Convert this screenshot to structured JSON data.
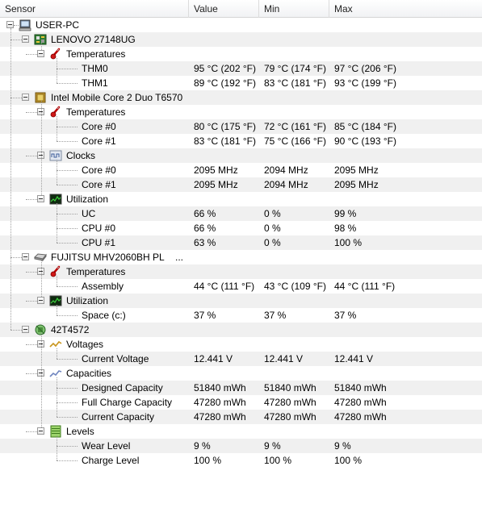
{
  "columns": {
    "sensor": "Sensor",
    "value": "Value",
    "min": "Min",
    "max": "Max"
  },
  "tree": {
    "root": "USER-PC",
    "devices": [
      {
        "name": "LENOVO 27148UG",
        "icon": "motherboard-icon",
        "groups": [
          {
            "name": "Temperatures",
            "icon": "thermometer-icon",
            "sensors": [
              {
                "name": "THM0",
                "value": "95 °C  (202 °F)",
                "min": "79 °C  (174 °F)",
                "max": "97 °C  (206 °F)"
              },
              {
                "name": "THM1",
                "value": "89 °C  (192 °F)",
                "min": "83 °C  (181 °F)",
                "max": "93 °C  (199 °F)"
              }
            ]
          }
        ]
      },
      {
        "name": "Intel Mobile Core 2 Duo T6570",
        "icon": "cpu-chip-icon",
        "groups": [
          {
            "name": "Temperatures",
            "icon": "thermometer-icon",
            "sensors": [
              {
                "name": "Core #0",
                "value": "80 °C  (175 °F)",
                "min": "72 °C  (161 °F)",
                "max": "85 °C  (184 °F)"
              },
              {
                "name": "Core #1",
                "value": "83 °C  (181 °F)",
                "min": "75 °C  (166 °F)",
                "max": "90 °C  (193 °F)"
              }
            ]
          },
          {
            "name": "Clocks",
            "icon": "clock-wave-icon",
            "sensors": [
              {
                "name": "Core #0",
                "value": "2095 MHz",
                "min": "2094 MHz",
                "max": "2095 MHz"
              },
              {
                "name": "Core #1",
                "value": "2095 MHz",
                "min": "2094 MHz",
                "max": "2095 MHz"
              }
            ]
          },
          {
            "name": "Utilization",
            "icon": "utilization-graph-icon",
            "sensors": [
              {
                "name": "UC",
                "value": "66 %",
                "min": "0 %",
                "max": "99 %"
              },
              {
                "name": "CPU #0",
                "value": "66 %",
                "min": "0 %",
                "max": "98 %"
              },
              {
                "name": "CPU #1",
                "value": "63 %",
                "min": "0 %",
                "max": "100 %"
              }
            ]
          }
        ]
      },
      {
        "name": "FUJITSU MHV2060BH PL",
        "suffix": "...",
        "icon": "hard-drive-icon",
        "groups": [
          {
            "name": "Temperatures",
            "icon": "thermometer-icon",
            "sensors": [
              {
                "name": "Assembly",
                "value": "44 °C  (111 °F)",
                "min": "43 °C  (109 °F)",
                "max": "44 °C  (111 °F)"
              }
            ]
          },
          {
            "name": "Utilization",
            "icon": "utilization-graph-icon",
            "sensors": [
              {
                "name": "Space (c:)",
                "value": "37 %",
                "min": "37 %",
                "max": "37 %"
              }
            ]
          }
        ]
      },
      {
        "name": "42T4572",
        "icon": "battery-icon",
        "groups": [
          {
            "name": "Voltages",
            "icon": "voltage-icon",
            "sensors": [
              {
                "name": "Current Voltage",
                "value": "12.441 V",
                "min": "12.441 V",
                "max": "12.441 V"
              }
            ]
          },
          {
            "name": "Capacities",
            "icon": "capacity-icon",
            "sensors": [
              {
                "name": "Designed Capacity",
                "value": "51840 mWh",
                "min": "51840 mWh",
                "max": "51840 mWh"
              },
              {
                "name": "Full Charge Capacity",
                "value": "47280 mWh",
                "min": "47280 mWh",
                "max": "47280 mWh"
              },
              {
                "name": "Current Capacity",
                "value": "47280 mWh",
                "min": "47280 mWh",
                "max": "47280 mWh"
              }
            ]
          },
          {
            "name": "Levels",
            "icon": "levels-icon",
            "sensors": [
              {
                "name": "Wear Level",
                "value": "9 %",
                "min": "9 %",
                "max": "9 %"
              },
              {
                "name": "Charge Level",
                "value": "100 %",
                "min": "100 %",
                "max": "100 %"
              }
            ]
          }
        ]
      }
    ]
  }
}
